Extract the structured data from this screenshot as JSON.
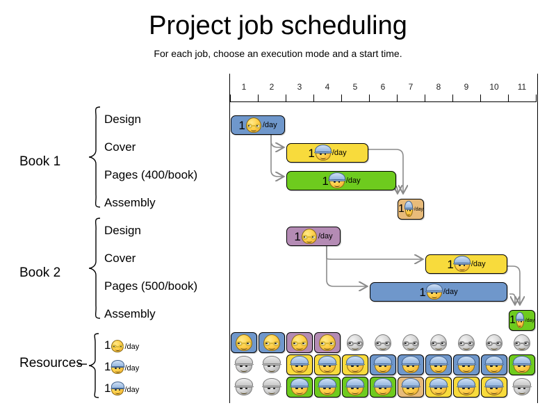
{
  "header": {
    "title": "Project job scheduling",
    "subtitle": "For each job, choose an execution mode and a start time."
  },
  "axis": {
    "label": "",
    "ticks": [
      "1",
      "2",
      "3",
      "4",
      "5",
      "6",
      "7",
      "8",
      "9",
      "10",
      "11"
    ],
    "range": [
      1,
      11
    ]
  },
  "groups": [
    {
      "name": "Book 1",
      "jobs": [
        "Design",
        "Cover",
        "Pages (400/book)",
        "Assembly"
      ]
    },
    {
      "name": "Book 2",
      "jobs": [
        "Design",
        "Cover",
        "Pages (500/book)",
        "Assembly"
      ]
    }
  ],
  "resources": {
    "name": "Resources",
    "rows": [
      {
        "count": "1",
        "icon": "glasses-face",
        "unit": "/day"
      },
      {
        "count": "1",
        "icon": "helmet-face",
        "unit": "/day"
      },
      {
        "count": "1",
        "icon": "helmet-face",
        "unit": "/day"
      }
    ]
  },
  "chart_data": {
    "type": "gantt",
    "title": "Project job scheduling",
    "xlabel": "",
    "ylabel": "",
    "xlim": [
      1,
      12
    ],
    "grid": false,
    "legend": "none",
    "colors": {
      "blue": "#6f97cb",
      "yellow": "#f8db3c",
      "green": "#6ecb1e",
      "orange": "#e8bb7a",
      "purple": "#b48bb4",
      "gray": "#cfcfcf"
    },
    "tasks": [
      {
        "group": "Book 1",
        "job": "Design",
        "start": 1,
        "end": 3,
        "duration": 2,
        "color": "#6f97cb",
        "count": "1",
        "icon": "glasses-face",
        "unit": "/day",
        "resource_row": 1
      },
      {
        "group": "Book 1",
        "job": "Cover",
        "start": 3,
        "end": 6,
        "duration": 3,
        "color": "#f8db3c",
        "count": "1",
        "icon": "helmet-face",
        "unit": "/day",
        "resource_row": 2
      },
      {
        "group": "Book 1",
        "job": "Pages (400/book)",
        "start": 3,
        "end": 7,
        "duration": 4,
        "color": "#6ecb1e",
        "count": "1",
        "icon": "helmet-face",
        "unit": "/day",
        "resource_row": 3
      },
      {
        "group": "Book 1",
        "job": "Assembly",
        "start": 7,
        "end": 8,
        "duration": 1,
        "color": "#e8bb7a",
        "count": "1",
        "icon": "helmet-face",
        "unit": "/day",
        "resource_row": 3
      },
      {
        "group": "Book 2",
        "job": "Design",
        "start": 3,
        "end": 5,
        "duration": 2,
        "color": "#b48bb4",
        "count": "1",
        "icon": "glasses-face",
        "unit": "/day",
        "resource_row": 1
      },
      {
        "group": "Book 2",
        "job": "Cover",
        "start": 8,
        "end": 11,
        "duration": 3,
        "color": "#f8db3c",
        "count": "1",
        "icon": "helmet-face",
        "unit": "/day",
        "resource_row": 3
      },
      {
        "group": "Book 2",
        "job": "Pages (500/book)",
        "start": 6,
        "end": 11,
        "duration": 5,
        "color": "#6f97cb",
        "count": "1",
        "icon": "helmet-face",
        "unit": "/day",
        "resource_row": 2
      },
      {
        "group": "Book 2",
        "job": "Assembly",
        "start": 11,
        "end": 12,
        "duration": 1,
        "color": "#6ecb1e",
        "count": "1",
        "icon": "helmet-face",
        "unit": "/day",
        "resource_row": 2
      }
    ],
    "dependencies": [
      {
        "from": "Book 1 Design",
        "to": "Book 1 Cover"
      },
      {
        "from": "Book 1 Design",
        "to": "Book 1 Pages (400/book)"
      },
      {
        "from": "Book 1 Cover",
        "to": "Book 1 Assembly"
      },
      {
        "from": "Book 1 Pages (400/book)",
        "to": "Book 1 Assembly"
      },
      {
        "from": "Book 2 Design",
        "to": "Book 2 Cover"
      },
      {
        "from": "Book 2 Design",
        "to": "Book 2 Pages (500/book)"
      },
      {
        "from": "Book 2 Cover",
        "to": "Book 2 Assembly"
      },
      {
        "from": "Book 2 Pages (500/book)",
        "to": "Book 2 Assembly"
      }
    ],
    "resource_utilisation": [
      {
        "resource": "1 glasses-face /day",
        "cells": [
          "#6f97cb",
          "#6f97cb",
          "#b48bb4",
          "#b48bb4",
          "idle",
          "idle",
          "idle",
          "idle",
          "idle",
          "idle",
          "idle"
        ]
      },
      {
        "resource": "1 helmet-face /day",
        "cells": [
          "idle",
          "idle",
          "#f8db3c",
          "#f8db3c",
          "#f8db3c",
          "#6f97cb",
          "#6f97cb",
          "#6f97cb",
          "#6f97cb",
          "#6f97cb",
          "#6ecb1e"
        ]
      },
      {
        "resource": "1 helmet-face /day",
        "cells": [
          "idle",
          "idle",
          "#6ecb1e",
          "#6ecb1e",
          "#6ecb1e",
          "#6ecb1e",
          "#e8bb7a",
          "#f8db3c",
          "#f8db3c",
          "#f8db3c",
          "idle"
        ]
      }
    ]
  }
}
